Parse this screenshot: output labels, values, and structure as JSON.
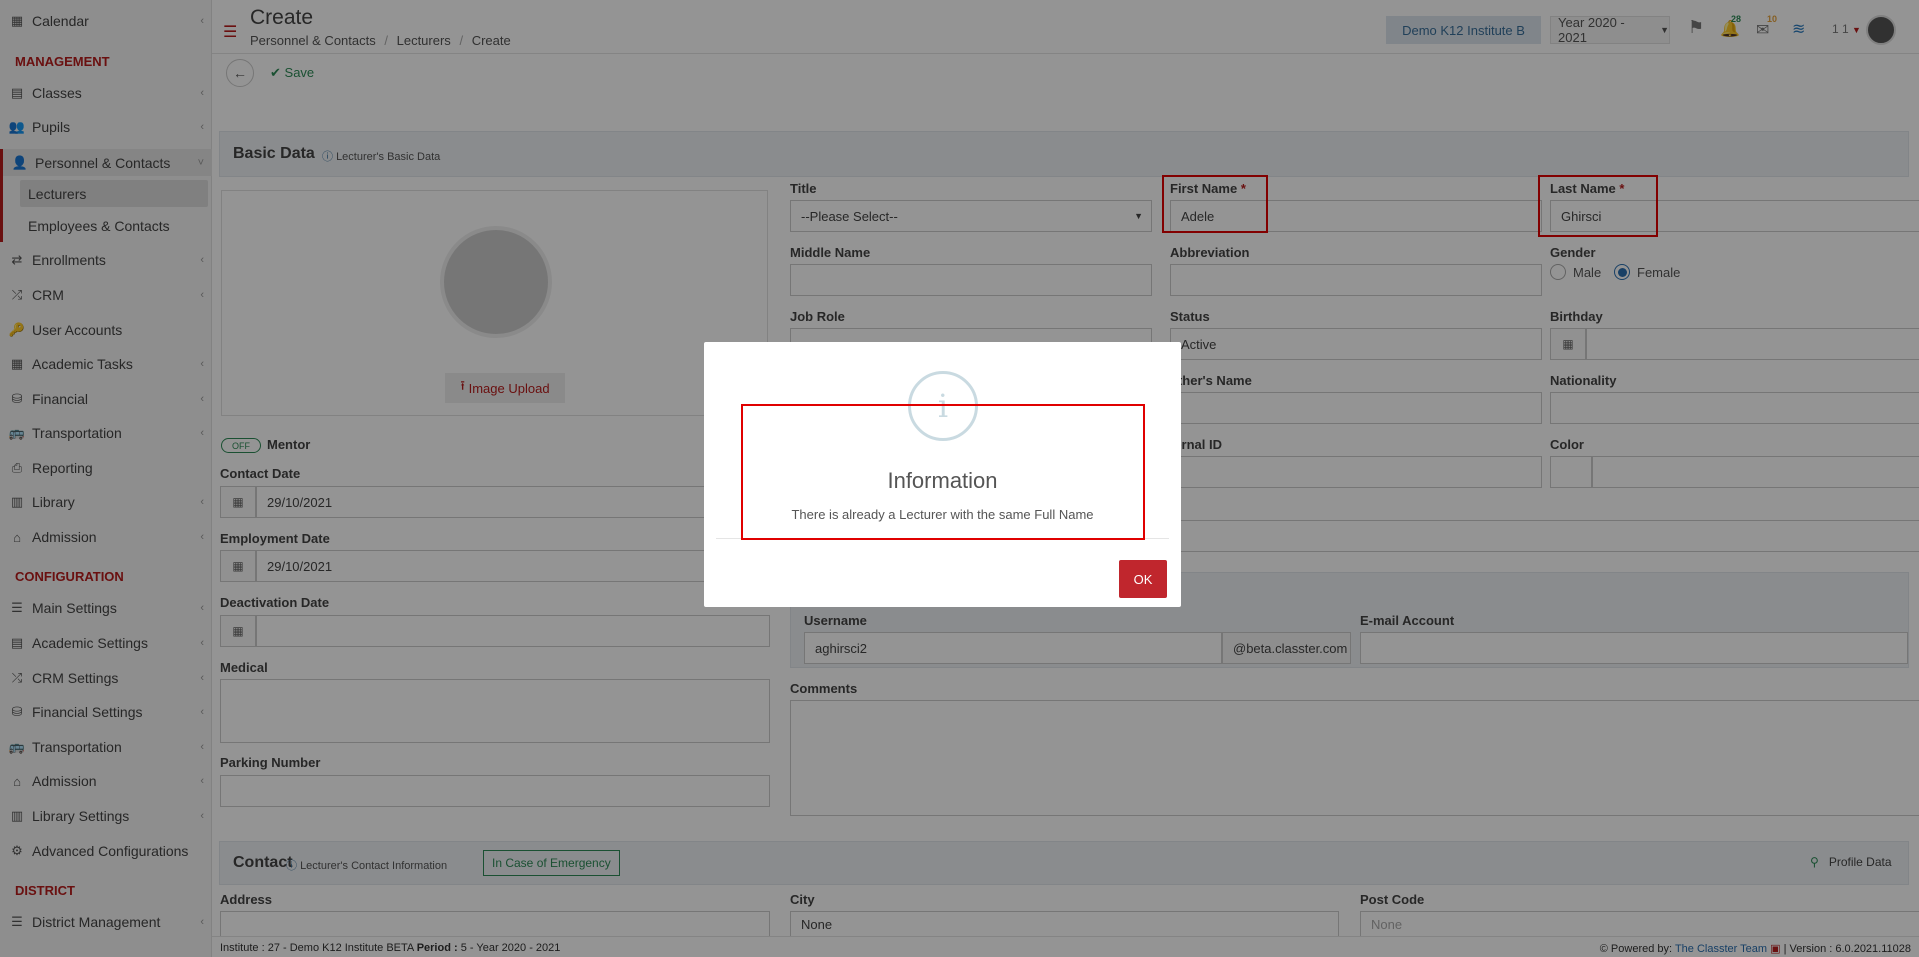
{
  "sidebar": {
    "calendar": "Calendar",
    "section_management": "MANAGEMENT",
    "classes": "Classes",
    "pupils": "Pupils",
    "personnel": "Personnel & Contacts",
    "lecturers": "Lecturers",
    "employees": "Employees & Contacts",
    "enrollments": "Enrollments",
    "crm": "CRM",
    "user_accounts": "User Accounts",
    "academic_tasks": "Academic Tasks",
    "financial": "Financial",
    "transportation": "Transportation",
    "reporting": "Reporting",
    "library": "Library",
    "admission": "Admission",
    "section_configuration": "CONFIGURATION",
    "main_settings": "Main Settings",
    "academic_settings": "Academic Settings",
    "crm_settings": "CRM Settings",
    "financial_settings": "Financial Settings",
    "transportation2": "Transportation",
    "admission2": "Admission",
    "library_settings": "Library Settings",
    "advanced_configurations": "Advanced Configurations",
    "section_district": "DISTRICT",
    "district_management": "District Management"
  },
  "header": {
    "title": "Create",
    "breadcrumb": [
      "Personnel & Contacts",
      "Lecturers",
      "Create"
    ],
    "institute": "Demo K12 Institute B",
    "year": "Year 2020 - 2021",
    "notif_count": "28",
    "mail_count": "10",
    "user": "1 1"
  },
  "toolbar": {
    "save": "Save"
  },
  "basic": {
    "title": "Basic Data",
    "subtitle": "Lecturer's Basic Data",
    "image_upload": "Image Upload",
    "mentor_toggle": "OFF",
    "mentor": "Mentor",
    "contact_date_label": "Contact Date",
    "contact_date": "29/10/2021",
    "employment_date_label": "Employment Date",
    "employment_date": "29/10/2021",
    "deactivation_label": "Deactivation Date",
    "medical_label": "Medical",
    "parking_label": "Parking Number",
    "title_label": "Title",
    "title_value": "--Please Select--",
    "first_name_label": "First Name",
    "first_name": "Adele",
    "last_name_label": "Last Name",
    "last_name": "Ghirsci",
    "middle_name_label": "Middle Name",
    "abbreviation_label": "Abbreviation",
    "gender_label": "Gender",
    "gender_male": "Male",
    "gender_female": "Female",
    "job_role_label": "Job Role",
    "status_label": "Status",
    "status_value": "Active",
    "birthday_label": "Birthday",
    "mothers_name_label": "other's Name",
    "nationality_label": "Nationality",
    "external_id_label": "ternal ID",
    "color_label": "Color",
    "username_label": "Username",
    "username": "aghirsci2",
    "domain": "@beta.classter.com",
    "email_label": "E-mail Account",
    "comments_label": "Comments"
  },
  "contact": {
    "title": "Contact",
    "subtitle": "Lecturer's Contact Information",
    "emergency": "In Case of Emergency",
    "profile_data": "Profile Data",
    "address_label": "Address",
    "city_label": "City",
    "city_value": "None",
    "postcode_label": "Post Code",
    "postcode_value": "None"
  },
  "modal": {
    "title": "Information",
    "message": "There is already a Lecturer with the same Full Name",
    "ok": "OK"
  },
  "footer": {
    "institute_label": "Institute :",
    "institute_value": "27 - Demo K12 Institute BETA",
    "period_label": "Period :",
    "period_value": "5 - Year 2020 - 2021",
    "powered_by": "Powered by:",
    "team": "The Classter Team",
    "version": "| Version : 6.0.2021.11028"
  }
}
